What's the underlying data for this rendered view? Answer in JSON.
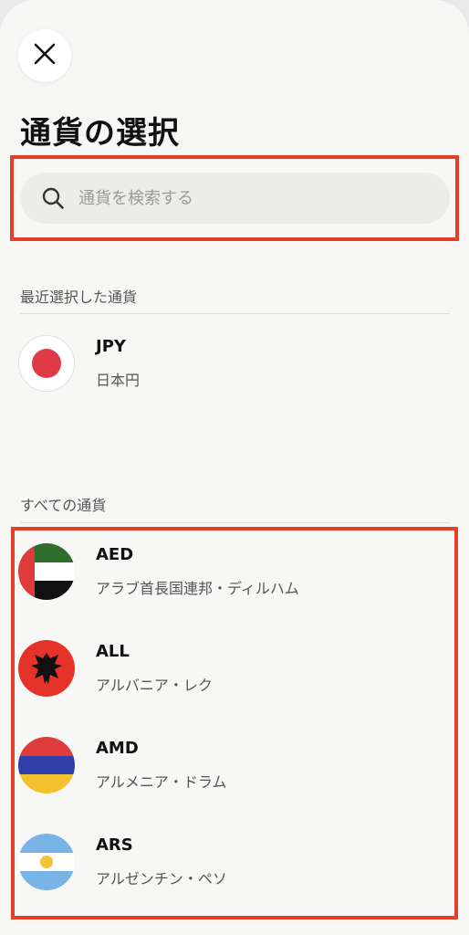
{
  "header": {
    "title": "通貨の選択"
  },
  "search": {
    "placeholder": "通貨を検索する",
    "icon": "search-icon"
  },
  "recent": {
    "title": "最近選択した通貨",
    "items": [
      {
        "code": "JPY",
        "name": "日本円"
      }
    ]
  },
  "all": {
    "title": "すべての通貨",
    "items": [
      {
        "code": "AED",
        "name": "アラブ首長国連邦・ディルハム"
      },
      {
        "code": "ALL",
        "name": "アルバニア・レク"
      },
      {
        "code": "AMD",
        "name": "アルメニア・ドラム"
      },
      {
        "code": "ARS",
        "name": "アルゼンチン・ペソ"
      }
    ]
  },
  "colors": {
    "highlight": "#e0402c",
    "background": "#f7f7f5",
    "search_bg": "#ecece8"
  }
}
